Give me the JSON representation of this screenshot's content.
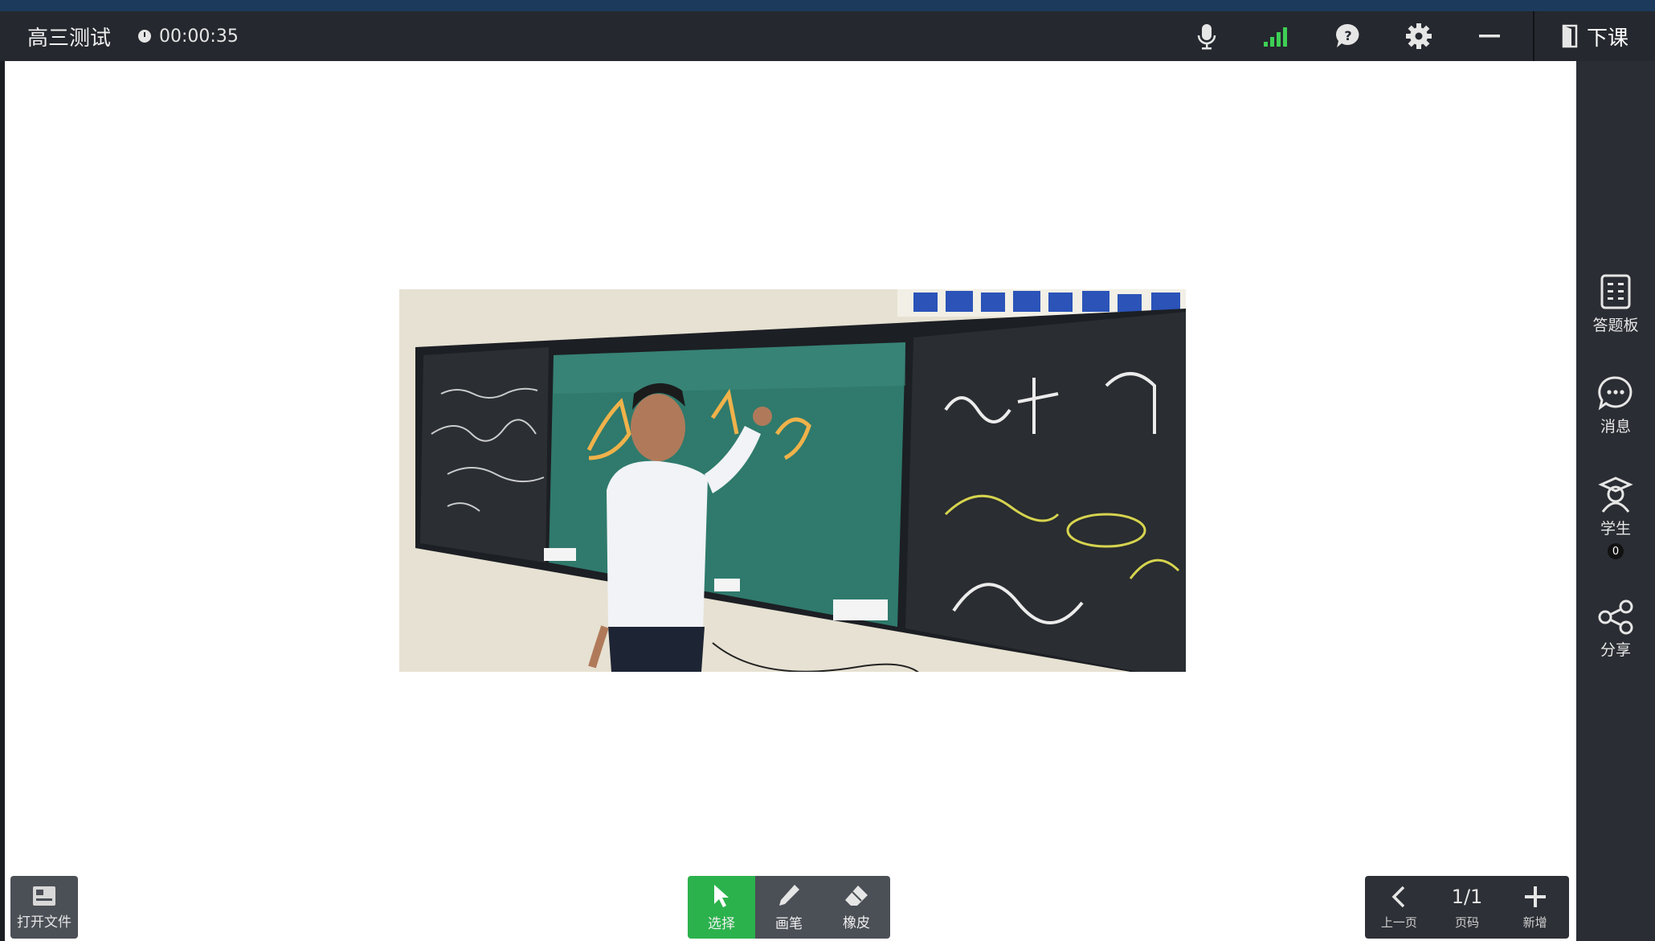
{
  "header": {
    "title": "高三测试",
    "timer": "00:00:35",
    "end_class_label": "下课"
  },
  "header_icons": [
    "microphone-icon",
    "signal-icon",
    "help-icon",
    "gear-icon",
    "minimize-icon"
  ],
  "colors": {
    "accent_green": "#2bb24c",
    "signal_green": "#3ecf55",
    "titlebar": "#25282e",
    "sidebar": "#2a2d33"
  },
  "sidebar": {
    "answer_board_label": "答题板",
    "messages_label": "消息",
    "students_label": "学生",
    "students_count": "0",
    "share_label": "分享"
  },
  "bottom": {
    "open_file_label": "打开文件",
    "tools": {
      "select_label": "选择",
      "pen_label": "画笔",
      "eraser_label": "橡皮"
    },
    "pager": {
      "prev_label": "上一页",
      "page_number": "1/1",
      "page_label": "页码",
      "add_label": "新增"
    }
  }
}
